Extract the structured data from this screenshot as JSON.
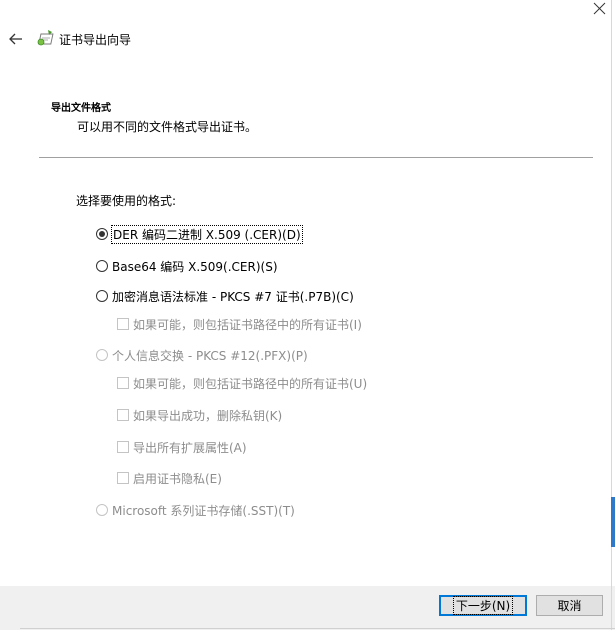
{
  "window": {
    "close_glyph": "✕",
    "title": "证书导出向导"
  },
  "header": {
    "section_title": "导出文件格式",
    "section_desc": "可以用不同的文件格式导出证书。"
  },
  "main": {
    "prompt": "选择要使用的格式:",
    "options": [
      {
        "label": "DER 编码二进制 X.509 (.CER)(D)",
        "type": "radio",
        "checked": true,
        "enabled": true
      },
      {
        "label": "Base64 编码 X.509(.CER)(S)",
        "type": "radio",
        "checked": false,
        "enabled": true
      },
      {
        "label": "加密消息语法标准 - PKCS #7 证书(.P7B)(C)",
        "type": "radio",
        "checked": false,
        "enabled": true
      },
      {
        "label": "如果可能，则包括证书路径中的所有证书(I)",
        "type": "checkbox",
        "checked": false,
        "enabled": false
      },
      {
        "label": "个人信息交换 - PKCS #12(.PFX)(P)",
        "type": "radio",
        "checked": false,
        "enabled": false
      },
      {
        "label": "如果可能，则包括证书路径中的所有证书(U)",
        "type": "checkbox",
        "checked": false,
        "enabled": false
      },
      {
        "label": "如果导出成功，删除私钥(K)",
        "type": "checkbox",
        "checked": false,
        "enabled": false
      },
      {
        "label": "导出所有扩展属性(A)",
        "type": "checkbox",
        "checked": false,
        "enabled": false
      },
      {
        "label": "启用证书隐私(E)",
        "type": "checkbox",
        "checked": false,
        "enabled": false
      },
      {
        "label": "Microsoft 系列证书存储(.SST)(T)",
        "type": "radio",
        "checked": false,
        "enabled": false
      }
    ]
  },
  "footer": {
    "next_label": "下一步(N)",
    "cancel_label": "取消"
  },
  "colors": {
    "accent": "#0078d7",
    "footer_bg": "#f0f0f0",
    "disabled_text": "#8d8d8d"
  },
  "icons": [
    "close-icon",
    "back-arrow-icon",
    "certificate-wizard-icon"
  ]
}
